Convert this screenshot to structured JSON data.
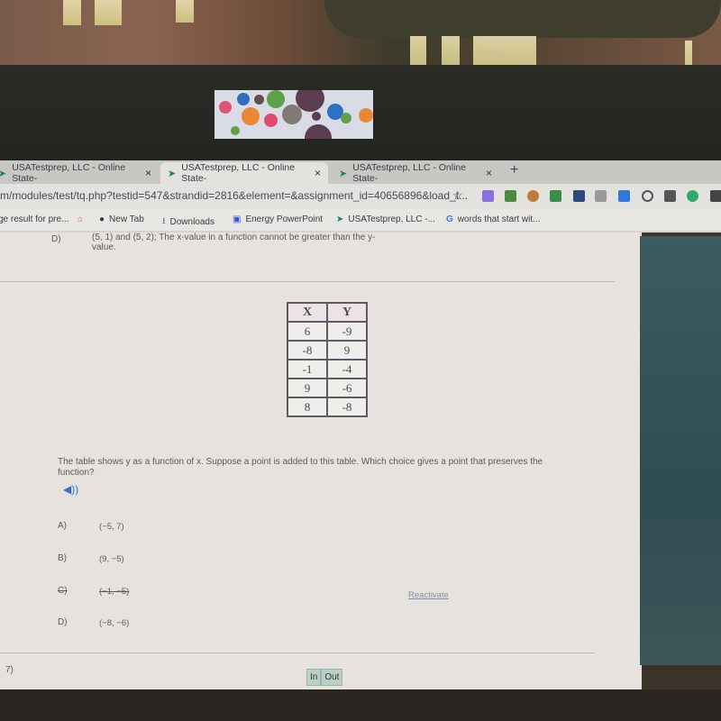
{
  "browser": {
    "tabs": [
      {
        "label": "USATestprep, LLC - Online State-",
        "close": "×",
        "active": false
      },
      {
        "label": "USATestprep, LLC - Online State-",
        "close": "×",
        "active": true
      },
      {
        "label": "USATestprep, LLC - Online State-",
        "close": "×",
        "active": false
      }
    ],
    "new_tab": "+",
    "url": "m/modules/test/tq.php?testid=547&strandid=2816&element=&assignment_id=40656896&load_t...",
    "bookmarks": [
      {
        "label": "ge result for pre...",
        "icon": "page-icon"
      },
      {
        "label": "",
        "icon": "home-icon"
      },
      {
        "label": "New Tab",
        "icon": "globe-icon"
      },
      {
        "label": "Downloads",
        "icon": "download-icon"
      },
      {
        "label": "Energy PowerPoint",
        "icon": "classroom-icon"
      },
      {
        "label": "USATestprep, LLC -...",
        "icon": "cursor-icon"
      },
      {
        "label": "words that start wit...",
        "icon": "google-icon"
      }
    ],
    "extensions": [
      "puzzle-icon",
      "classroom-icon",
      "chrome-icon",
      "cast-icon",
      "camera-icon",
      "box-icon",
      "b-icon",
      "power-icon",
      "qr-icon",
      "grammarly-icon"
    ]
  },
  "prev_question": {
    "letter": "D)",
    "text_line1": "(5, 1) and (5, 2); The x-value in a function cannot be greater than the y-",
    "text_line2": "value."
  },
  "table": {
    "headers": [
      "X",
      "Y"
    ],
    "rows": [
      [
        "6",
        "-9"
      ],
      [
        "-8",
        "9"
      ],
      [
        "-1",
        "-4"
      ],
      [
        "9",
        "-6"
      ],
      [
        "8",
        "-8"
      ]
    ]
  },
  "question": {
    "text": "The table shows y as a function of x. Suppose a point is added to this table. Which choice gives a point that preserves the function?",
    "audio_icon": "speaker-icon",
    "choices": [
      {
        "letter": "A)",
        "value": "(−5, 7)",
        "struck": false
      },
      {
        "letter": "B)",
        "value": "(9, −5)",
        "struck": false
      },
      {
        "letter": "C)",
        "value": "(−1, −5)",
        "struck": true
      },
      {
        "letter": "D)",
        "value": "(−8, −6)",
        "struck": false
      }
    ],
    "reactivate_label": "Reactivate"
  },
  "next_question_number": "7)",
  "zoom_controls": {
    "in_label": "In",
    "out_label": "Out"
  }
}
